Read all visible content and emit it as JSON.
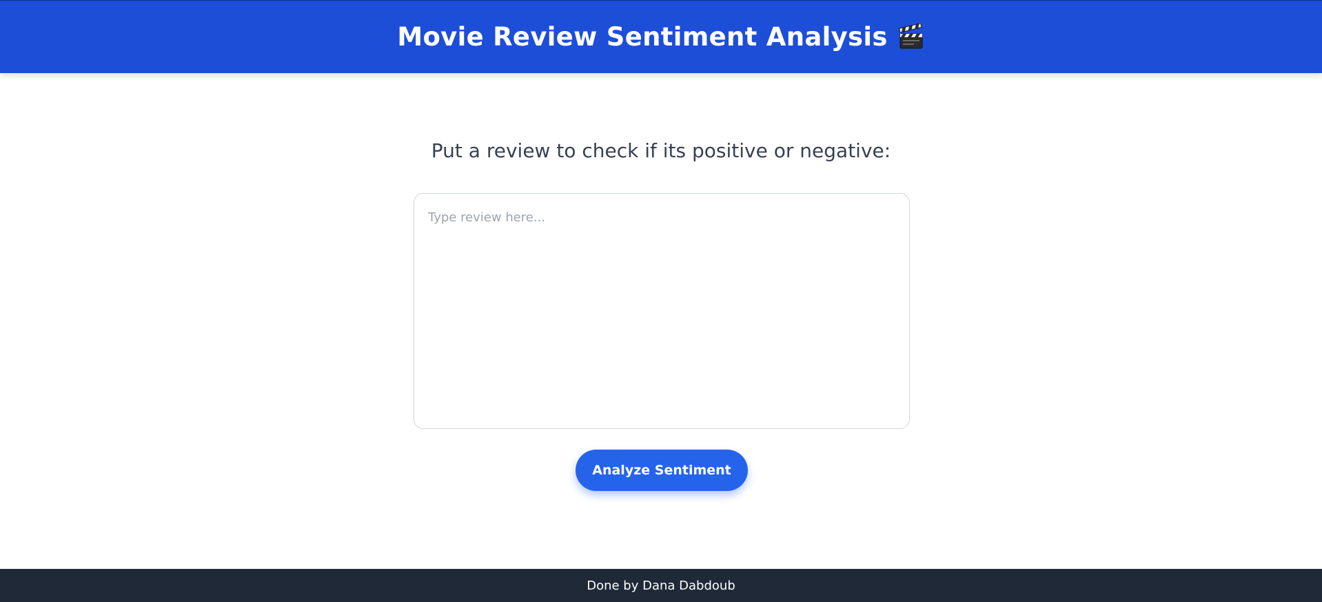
{
  "header": {
    "title": "Movie Review Sentiment Analysis",
    "icon": "clapperboard-icon",
    "background_color": "#1d4ed8"
  },
  "main": {
    "prompt": "Put a review to check if its positive or negative:",
    "review_input": {
      "value": "",
      "placeholder": "Type review here..."
    },
    "analyze_button_label": "Analyze Sentiment",
    "button_color": "#2563eb"
  },
  "footer": {
    "text": "Done by Dana Dabdoub",
    "background_color": "#1f2937"
  }
}
